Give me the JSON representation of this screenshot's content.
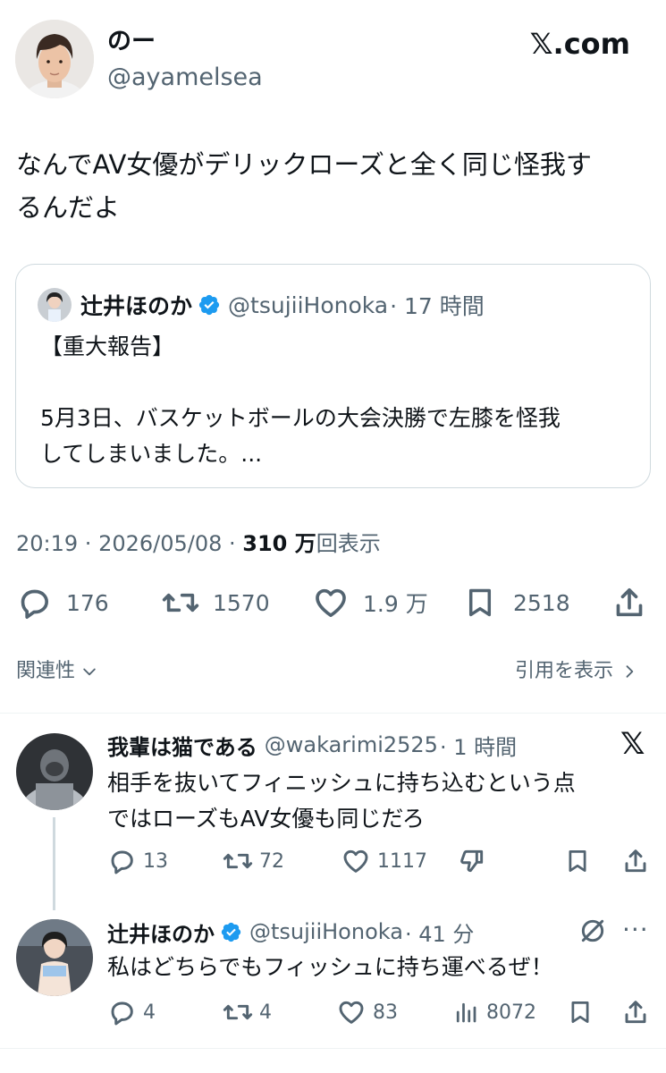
{
  "author": {
    "name": "のー",
    "handle": "@ayamelsea"
  },
  "brand": {
    "logo_text": "𝕏.com"
  },
  "tweet": {
    "text_line1": "なんでAV女優がデリックローズと全く同じ怪我す",
    "text_line2": "るんだよ"
  },
  "quote": {
    "name": "辻井ほのか",
    "handle": "@tsujiiHonoka",
    "time": "· 17 時間",
    "line1": "【重大報告】",
    "line2": "5月3日、バスケットボールの大会決勝で左膝を怪我",
    "line3": "してしまいました。..."
  },
  "meta": {
    "time": "20:19",
    "sep1": " · ",
    "date": "2026/05/08",
    "sep2": " · ",
    "views_value": "310 万",
    "views_label": "回表示"
  },
  "actions": {
    "replies": "176",
    "retweets": "1570",
    "likes": "1.9 万",
    "bookmarks": "2518"
  },
  "related": {
    "label": "関連性",
    "quotes_link": "引用を表示"
  },
  "replies": [
    {
      "name": "我輩は猫である",
      "handle": "@wakarimi2525",
      "time": "· 1 時間",
      "line1": "相手を抜いてフィニッシュに持ち込むという点",
      "line2": "ではローズもAV女優も同じだろ",
      "reply_count": "13",
      "retweet_count": "72",
      "like_count": "1117"
    },
    {
      "name": "辻井ほのか",
      "handle": "@tsujiiHonoka",
      "time": "· 41 分",
      "line1": "私はどちらでもフィッシュに持ち運べるぜ！",
      "reply_count": "4",
      "retweet_count": "4",
      "like_count": "83",
      "view_count": "8072"
    }
  ],
  "colors": {
    "verified": "#1d9bf0",
    "text": "#0f1419",
    "secondary": "#536471",
    "border": "#cfd9de"
  }
}
